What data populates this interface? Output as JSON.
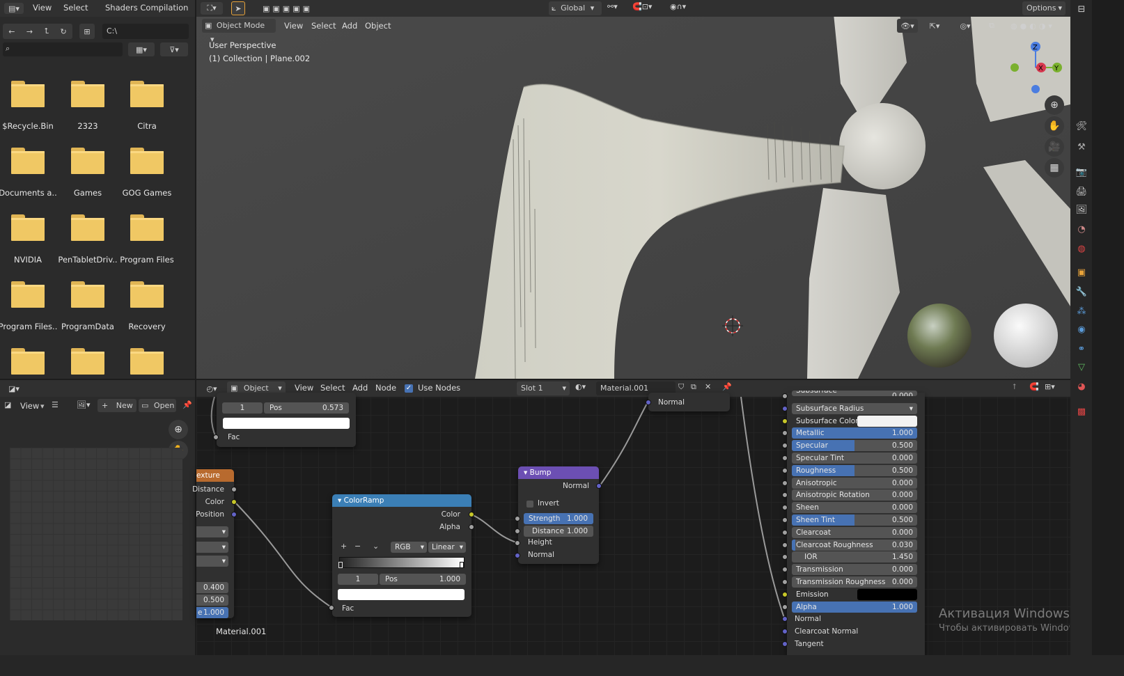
{
  "top_menu": {
    "view": "View",
    "select": "Select",
    "shaders_compilation": "Shaders Compilation"
  },
  "file_browser": {
    "path": "C:\\",
    "search_placeholder": "",
    "folders": [
      "$Recycle.Bin",
      "2323",
      "Citra",
      "Documents a..",
      "Games",
      "GOG Games",
      "NVIDIA",
      "PenTabletDriv..",
      "Program Files",
      "Program Files..",
      "ProgramData",
      "Recovery",
      "",
      "",
      ""
    ]
  },
  "viewport": {
    "mode": "Object Mode",
    "view": "View",
    "select": "Select",
    "add": "Add",
    "object": "Object",
    "transform_orientation": "Global",
    "options": "Options",
    "perspective": "User Perspective",
    "collection": "(1) Collection | Plane.002",
    "gizmo": {
      "x": "X",
      "y": "Y",
      "z": "Z"
    }
  },
  "image_editor": {
    "view": "View",
    "new": "New",
    "open": "Open"
  },
  "node_editor": {
    "type": "Object",
    "view": "View",
    "select": "Select",
    "add": "Add",
    "node": "Node",
    "use_nodes": "Use Nodes",
    "slot": "Slot 1",
    "material": "Material.001",
    "material_label": "Material.001"
  },
  "nodes": {
    "top_ramp": {
      "index": "1",
      "pos_label": "Pos",
      "pos_value": "0.573",
      "fac": "Fac"
    },
    "texture": {
      "title": "exture",
      "outputs": [
        "Distance",
        "Color",
        "Position"
      ],
      "values": [
        "0.400",
        "0.500",
        "1.000"
      ],
      "last_prefix": "e"
    },
    "colorramp": {
      "title": "ColorRamp",
      "color": "Color",
      "alpha": "Alpha",
      "mode": "RGB",
      "interp": "Linear",
      "index": "1",
      "pos_label": "Pos",
      "pos_value": "1.000",
      "fac": "Fac"
    },
    "bump": {
      "title": "Bump",
      "normal_out": "Normal",
      "invert": "Invert",
      "strength_label": "Strength",
      "strength": "1.000",
      "distance_label": "Distance",
      "distance": "1.000",
      "height": "Height",
      "normal_in": "Normal"
    },
    "normal_map": {
      "normal": "Normal"
    }
  },
  "bsdf": {
    "rows": [
      {
        "name": "Subsurface",
        "value": "0.000",
        "fill": 0
      },
      {
        "name": "Subsurface Radius",
        "value": "",
        "fill": 0
      },
      {
        "name": "Subsurface Color",
        "value": "",
        "fill": 0
      },
      {
        "name": "Metallic",
        "value": "1.000",
        "fill": 1.0
      },
      {
        "name": "Specular",
        "value": "0.500",
        "fill": 0.5
      },
      {
        "name": "Specular Tint",
        "value": "0.000",
        "fill": 0
      },
      {
        "name": "Roughness",
        "value": "0.500",
        "fill": 0.5
      },
      {
        "name": "Anisotropic",
        "value": "0.000",
        "fill": 0
      },
      {
        "name": "Anisotropic Rotation",
        "value": "0.000",
        "fill": 0
      },
      {
        "name": "Sheen",
        "value": "0.000",
        "fill": 0
      },
      {
        "name": "Sheen Tint",
        "value": "0.500",
        "fill": 0.5
      },
      {
        "name": "Clearcoat",
        "value": "0.000",
        "fill": 0
      },
      {
        "name": "Clearcoat Roughness",
        "value": "0.030",
        "fill": 0.03
      },
      {
        "name": "IOR",
        "value": "1.450",
        "fill": 0
      },
      {
        "name": "Transmission",
        "value": "0.000",
        "fill": 0
      },
      {
        "name": "Transmission Roughness",
        "value": "0.000",
        "fill": 0
      },
      {
        "name": "Emission",
        "value": "",
        "fill": 0
      },
      {
        "name": "Alpha",
        "value": "1.000",
        "fill": 1.0
      }
    ],
    "inputs": [
      "Normal",
      "Clearcoat Normal",
      "Tangent"
    ]
  },
  "watermark": {
    "title": "Активация Windows",
    "subtitle": "Чтобы активировать Windows, п"
  }
}
